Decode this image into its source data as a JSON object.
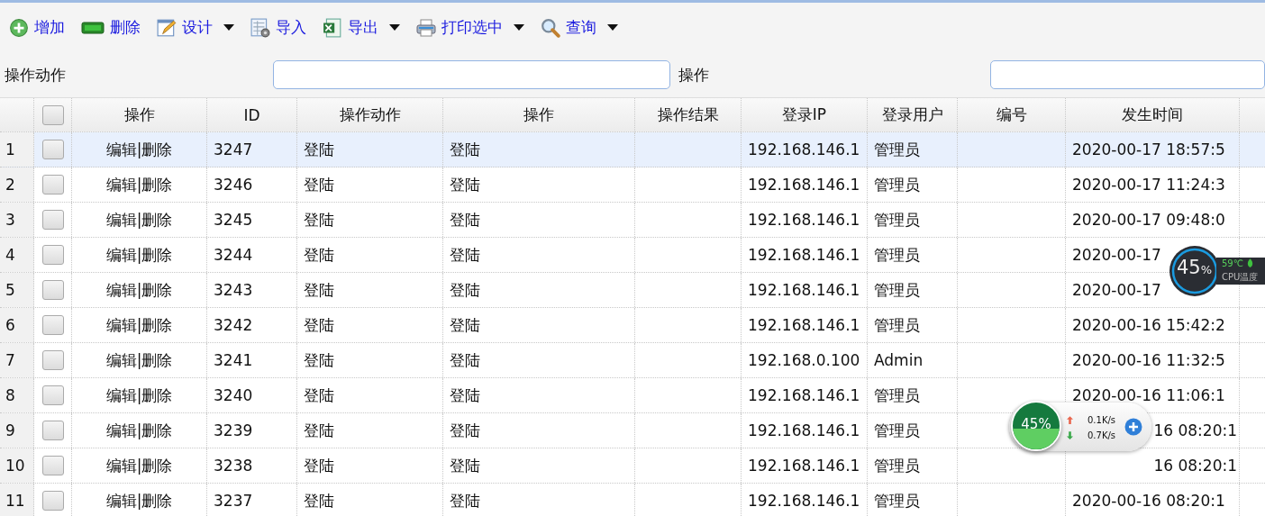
{
  "toolbar": [
    {
      "label": "增加",
      "kind": "add",
      "dropdown": false
    },
    {
      "label": "删除",
      "kind": "remove",
      "dropdown": false
    },
    {
      "label": "设计",
      "kind": "design",
      "dropdown": true
    },
    {
      "label": "导入",
      "kind": "import",
      "dropdown": false
    },
    {
      "label": "导出",
      "kind": "export",
      "dropdown": true
    },
    {
      "label": "打印选中",
      "kind": "print",
      "dropdown": true
    },
    {
      "label": "查询",
      "kind": "search",
      "dropdown": true
    }
  ],
  "filters": [
    {
      "label": "操作动作"
    },
    {
      "label": "操作"
    }
  ],
  "table": {
    "select_all_checked": false,
    "link_separator": "|",
    "columns": [
      "操作",
      "ID",
      "操作动作",
      "操作",
      "操作结果",
      "登录IP",
      "登录用户",
      "编号",
      "发生时间"
    ],
    "rows": [
      {
        "num": "1",
        "selected": true,
        "checked": false,
        "edit": "编辑",
        "delete": "删除",
        "id": "3247",
        "action": "登陆",
        "op": "登陆",
        "ip": "192.168.146.1",
        "user": "管理员",
        "time": "2020-00-17 18:57:5",
        "time_covered": false
      },
      {
        "num": "2",
        "selected": false,
        "checked": false,
        "edit": "编辑",
        "delete": "删除",
        "id": "3246",
        "action": "登陆",
        "op": "登陆",
        "ip": "192.168.146.1",
        "user": "管理员",
        "time": "2020-00-17 11:24:3",
        "time_covered": false
      },
      {
        "num": "3",
        "selected": false,
        "checked": false,
        "edit": "编辑",
        "delete": "删除",
        "id": "3245",
        "action": "登陆",
        "op": "登陆",
        "ip": "192.168.146.1",
        "user": "管理员",
        "time": "2020-00-17 09:48:0",
        "time_covered": false
      },
      {
        "num": "4",
        "selected": false,
        "checked": false,
        "edit": "编辑",
        "delete": "删除",
        "id": "3244",
        "action": "登陆",
        "op": "登陆",
        "ip": "192.168.146.1",
        "user": "管理员",
        "time": "2020-00-17",
        "time_covered": false
      },
      {
        "num": "5",
        "selected": false,
        "checked": false,
        "edit": "编辑",
        "delete": "删除",
        "id": "3243",
        "action": "登陆",
        "op": "登陆",
        "ip": "192.168.146.1",
        "user": "管理员",
        "time": "2020-00-17",
        "time_covered": false
      },
      {
        "num": "6",
        "selected": false,
        "checked": false,
        "edit": "编辑",
        "delete": "删除",
        "id": "3242",
        "action": "登陆",
        "op": "登陆",
        "ip": "192.168.146.1",
        "user": "管理员",
        "time": "2020-00-16 15:42:2",
        "time_covered": false
      },
      {
        "num": "7",
        "selected": false,
        "checked": false,
        "edit": "编辑",
        "delete": "删除",
        "id": "3241",
        "action": "登陆",
        "op": "登陆",
        "ip": "192.168.0.100",
        "user": "Admin",
        "time": "2020-00-16 11:32:5",
        "time_covered": false
      },
      {
        "num": "8",
        "selected": false,
        "checked": false,
        "edit": "编辑",
        "delete": "删除",
        "id": "3240",
        "action": "登陆",
        "op": "登陆",
        "ip": "192.168.146.1",
        "user": "管理员",
        "time": "2020-00-16 11:06:1",
        "time_covered": false
      },
      {
        "num": "9",
        "selected": false,
        "checked": false,
        "edit": "编辑",
        "delete": "删除",
        "id": "3239",
        "action": "登陆",
        "op": "登陆",
        "ip": "192.168.146.1",
        "user": "管理员",
        "time": "16 08:20:1",
        "time_covered": true
      },
      {
        "num": "10",
        "selected": false,
        "checked": false,
        "edit": "编辑",
        "delete": "删除",
        "id": "3238",
        "action": "登陆",
        "op": "登陆",
        "ip": "192.168.146.1",
        "user": "管理员",
        "time": "16 08:20:1",
        "time_covered": true
      },
      {
        "num": "11",
        "selected": false,
        "checked": false,
        "edit": "编辑",
        "delete": "删除",
        "id": "3237",
        "action": "登陆",
        "op": "登陆",
        "ip": "192.168.146.1",
        "user": "管理员",
        "time": "2020-00-16 08:20:1",
        "time_covered": false
      }
    ]
  },
  "cpu_widget": {
    "percent": "45",
    "unit": "%",
    "temperature": "59℃",
    "label": "CPU温度"
  },
  "net_widget": {
    "percent": "45%",
    "upload": "0.1K/s",
    "download": "0.7K/s"
  }
}
